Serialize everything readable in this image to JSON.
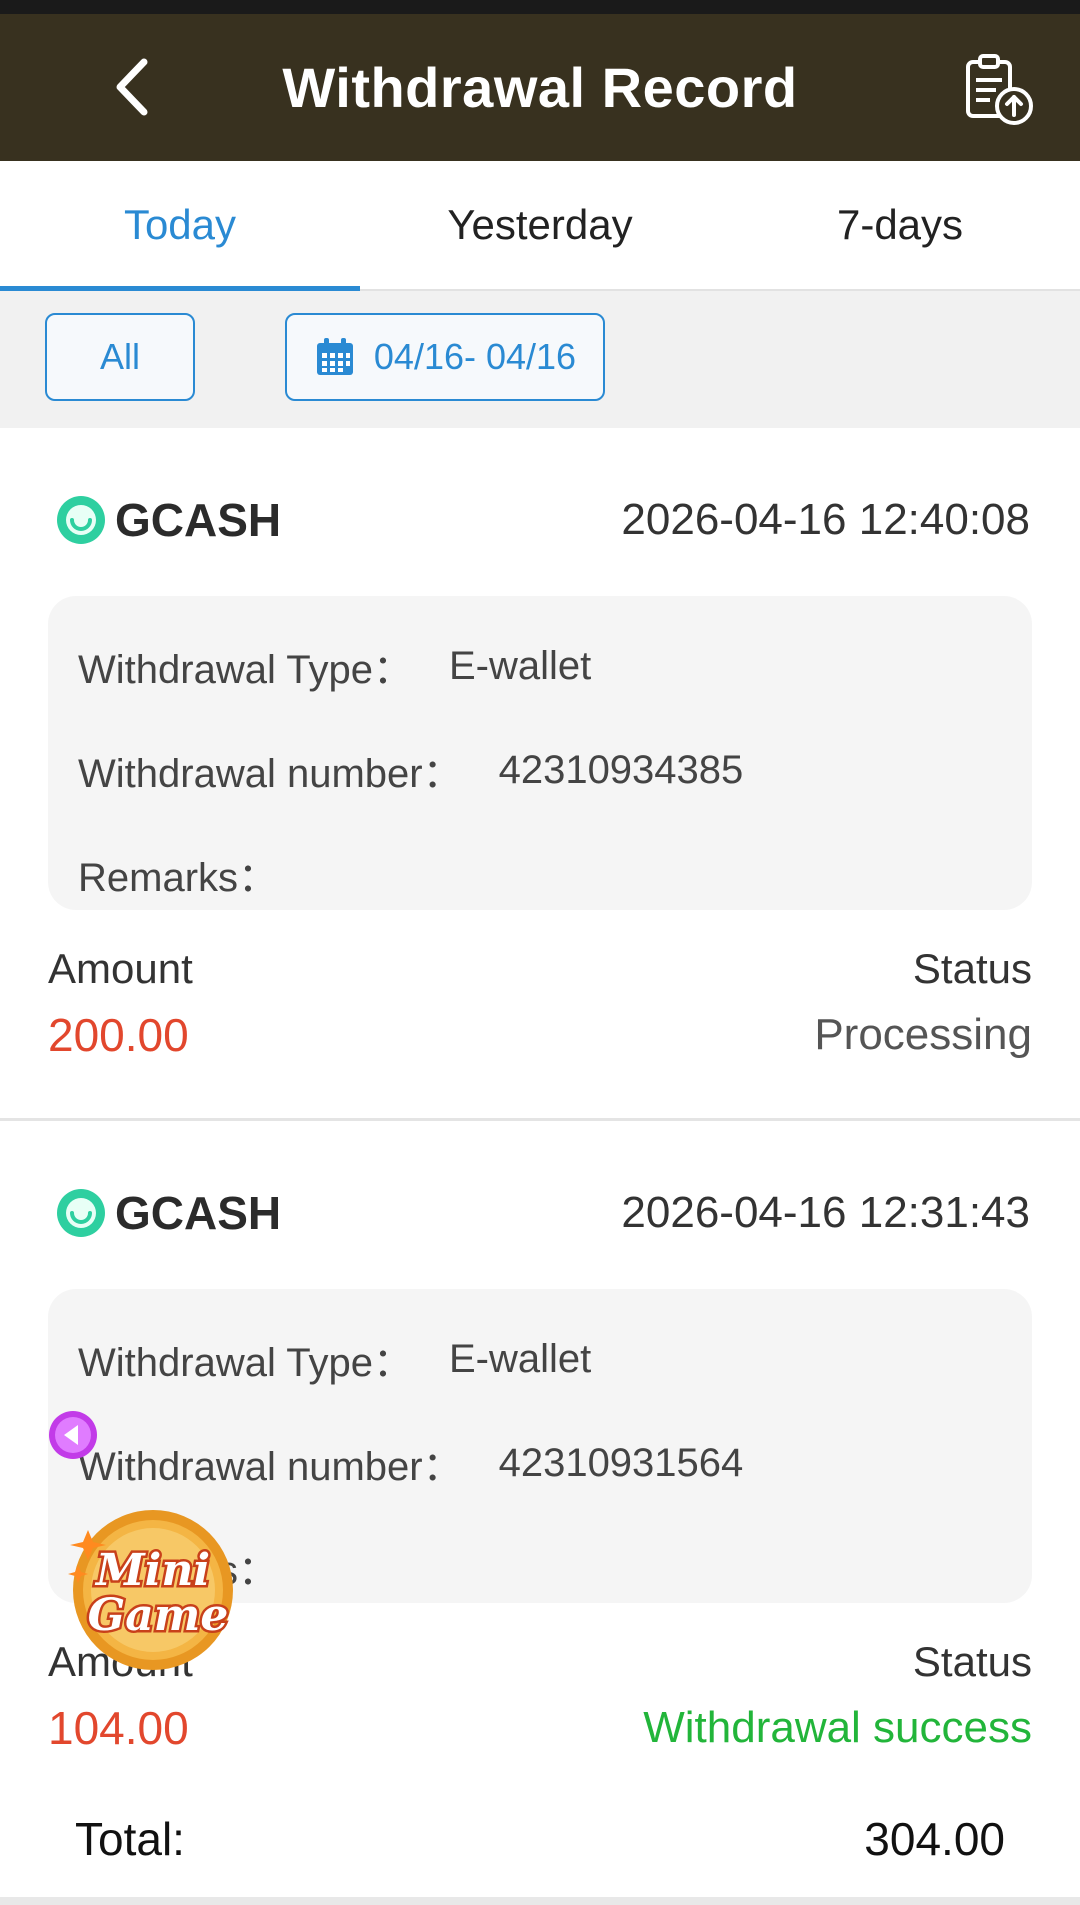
{
  "header": {
    "title": "Withdrawal Record",
    "back_icon": "chevron-left-icon",
    "record_icon": "clipboard-upload-icon"
  },
  "tabs": [
    {
      "label": "Today",
      "active": true
    },
    {
      "label": "Yesterday",
      "active": false
    },
    {
      "label": "7-days",
      "active": false
    }
  ],
  "filters": {
    "all_label": "All",
    "date_range": "04/16- 04/16",
    "date_icon": "calendar-icon"
  },
  "colors": {
    "accent": "#2a8ad3",
    "header_bg": "#38311f",
    "amount": "#e2472d",
    "success": "#22b53a"
  },
  "records": [
    {
      "method": "GCASH",
      "time": "2026-04-16 12:40:08",
      "type_label": "Withdrawal Type：",
      "type_value": "E-wallet",
      "number_label": "Withdrawal number：",
      "number_value": "42310934385",
      "remarks_label": "Remarks：",
      "amount_label": "Amount",
      "amount": "200.00",
      "status_label": "Status",
      "status": "Processing"
    },
    {
      "method": "GCASH",
      "time": "2026-04-16 12:31:43",
      "type_label": "Withdrawal Type：",
      "type_value": "E-wallet",
      "number_label": "Withdrawal number：",
      "number_value": "42310931564",
      "remarks_label": "Remarks：",
      "amount_label": "Amount",
      "amount": "104.00",
      "status_label": "Status",
      "status": "Withdrawal success"
    }
  ],
  "total": {
    "label": "Total:",
    "value": "304.00"
  },
  "floating": {
    "mini_game_line1": "Mini",
    "mini_game_line2": "Game"
  }
}
